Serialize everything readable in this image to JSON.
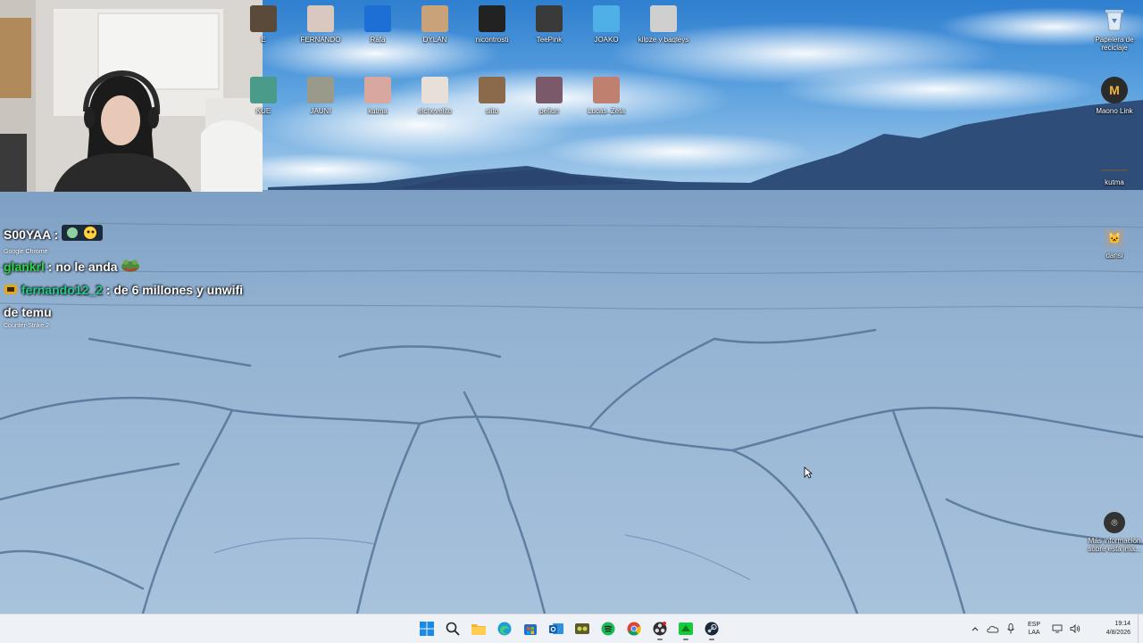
{
  "desktop": {
    "icons_row1": [
      {
        "label": "E",
        "icon": "cut-off-icon",
        "color": "#5a4a3a"
      },
      {
        "label": "FERNANDO",
        "icon": "cat-photo-icon",
        "color": "#d8c8c0"
      },
      {
        "label": "Rafa",
        "icon": "rocket-league-icon",
        "color": "#1d6fd6"
      },
      {
        "label": "DYLAN",
        "icon": "photo-icon",
        "color": "#c9a27a"
      },
      {
        "label": "nicontrosti",
        "icon": "dark-figure-icon",
        "color": "#222222"
      },
      {
        "label": "TeePink",
        "icon": "counter-strike-icon",
        "color": "#3a3a3a"
      },
      {
        "label": "JOAKO",
        "icon": "stumble-guys-icon",
        "color": "#4fb0e8"
      },
      {
        "label": "kilpze y baqleys",
        "icon": "photo-icon",
        "color": "#cfcfcf"
      }
    ],
    "icons_row2": [
      {
        "label": "KUE",
        "icon": "cut-off-icon",
        "color": "#4a9b8a"
      },
      {
        "label": "JAUNI",
        "icon": "dog-photo-icon",
        "color": "#9a9a8a"
      },
      {
        "label": "kutma",
        "icon": "pet-photo-icon",
        "color": "#d8a8a0"
      },
      {
        "label": "elchevelito",
        "icon": "cat-photo-icon",
        "color": "#e8e0d8"
      },
      {
        "label": "siito",
        "icon": "photo-icon",
        "color": "#8a6a4a"
      },
      {
        "label": "pefiun",
        "icon": "character-icon",
        "color": "#7a5a6a"
      },
      {
        "label": "Lucas_Zeta",
        "icon": "pet-photo-icon",
        "color": "#c08070"
      }
    ],
    "right_icons": [
      {
        "label": "Papelera de reciclaje",
        "icon": "recycle-bin-icon"
      },
      {
        "label": "Maono Link",
        "icon": "maono-link-icon"
      },
      {
        "label": "kutma",
        "icon": "small-photo-icon"
      },
      {
        "label": "dansi",
        "icon": "pet-photo-icon"
      },
      {
        "label": "Más información sobre esta ima...",
        "icon": "camera-info-icon"
      }
    ]
  },
  "chat": {
    "messages": [
      {
        "user": "S00YAA",
        "text": ""
      },
      {
        "user": "glankrl",
        "text": ": no le anda"
      },
      {
        "user": "fernando12_2",
        "text": ": de 6 millones y unwifi de temu"
      }
    ],
    "underlay_labels": [
      "Google Chrome",
      "Counter-Strike 2"
    ]
  },
  "taskbar": {
    "apps": [
      {
        "name": "start",
        "icon": "windows-start-icon"
      },
      {
        "name": "search",
        "icon": "search-icon"
      },
      {
        "name": "explorer",
        "icon": "folder-icon"
      },
      {
        "name": "edge",
        "icon": "edge-icon"
      },
      {
        "name": "store",
        "icon": "store-icon"
      },
      {
        "name": "outlook",
        "icon": "outlook-icon"
      },
      {
        "name": "game",
        "icon": "game-icon"
      },
      {
        "name": "spotify",
        "icon": "spotify-icon"
      },
      {
        "name": "chrome",
        "icon": "chrome-icon"
      },
      {
        "name": "obs",
        "icon": "obs-icon"
      },
      {
        "name": "green-app",
        "icon": "green-app-icon"
      },
      {
        "name": "steam",
        "icon": "steam-icon"
      }
    ],
    "tray": {
      "lang_line1": "ESP",
      "lang_line2": "LAA",
      "time": "19:14",
      "date": "4/8/2026"
    }
  }
}
